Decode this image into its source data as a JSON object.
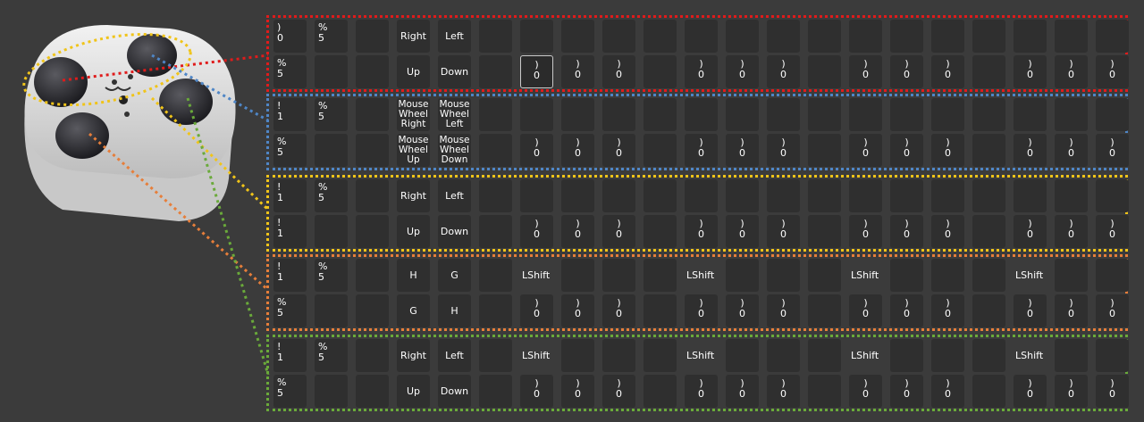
{
  "colors": {
    "background": "#3b3b3b",
    "key": "#2f2f2f",
    "red": "#e01b1b",
    "blue": "#4f86c6",
    "yellow": "#f0c419",
    "orange": "#e67e3a",
    "green": "#6aaa3a"
  },
  "device_image": {
    "name": "controller-device",
    "parts": [
      "top-left-button",
      "top-right-button",
      "bottom-left-joystick",
      "bottom-right-joystick",
      "face-icon"
    ]
  },
  "groups": [
    {
      "id": "red",
      "row1": {
        "c1": ")\n0",
        "c2": "%\n5",
        "c4": "Right",
        "c5": "Left"
      },
      "row2": {
        "c1": "%\n5",
        "c4": "Up",
        "c5": "Down"
      },
      "row2_value": ")\n0"
    },
    {
      "id": "blue",
      "row1": {
        "c1": "!\n1",
        "c2": "%\n5",
        "c4": "Mouse\nWheel\nRight",
        "c5": "Mouse\nWheel\nLeft"
      },
      "row2": {
        "c1": "%\n5",
        "c4": "Mouse\nWheel\nUp",
        "c5": "Mouse\nWheel\nDown"
      },
      "row2_value": ")\n0"
    },
    {
      "id": "yellow",
      "row1": {
        "c1": "!\n1",
        "c2": "%\n5",
        "c4": "Right",
        "c5": "Left"
      },
      "row2": {
        "c1": "!\n1",
        "c4": "Up",
        "c5": "Down"
      },
      "row2_value": ")\n0"
    },
    {
      "id": "orange",
      "row1": {
        "c1": "!\n1",
        "c2": "%\n5",
        "c4": "H",
        "c5": "G",
        "shift": "LShift"
      },
      "row2": {
        "c1": "%\n5",
        "c4": "G",
        "c5": "H"
      },
      "row2_value": ")\n0"
    },
    {
      "id": "green",
      "row1": {
        "c1": "!\n1",
        "c2": "%\n5",
        "c4": "Right",
        "c5": "Left",
        "shift": "LShift"
      },
      "row2": {
        "c1": "%\n5",
        "c4": "Up",
        "c5": "Down"
      },
      "row2_value": ")\n0"
    }
  ]
}
